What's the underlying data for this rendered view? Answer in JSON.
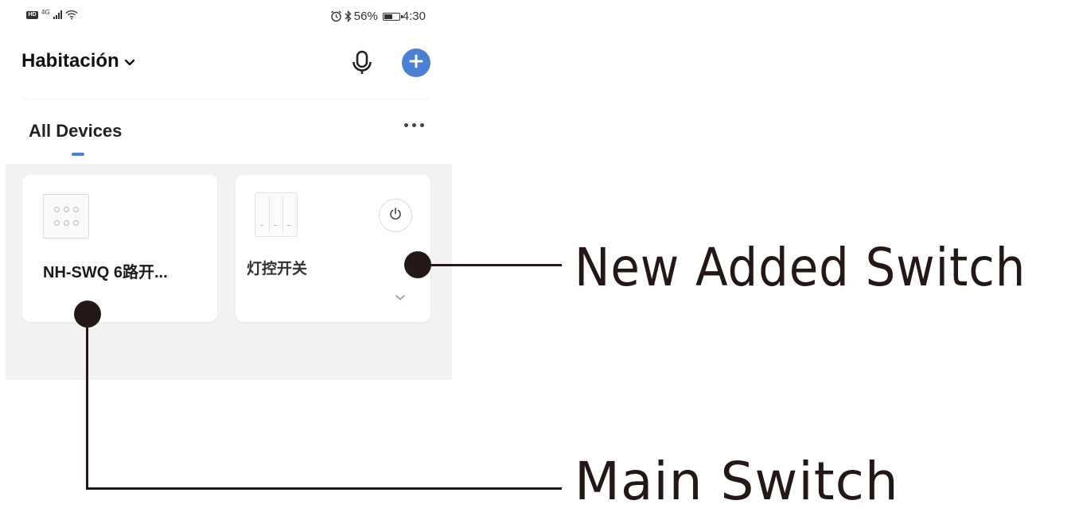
{
  "status_bar": {
    "hd": "HD",
    "network": "4G",
    "battery_percent": "56%",
    "battery_level": 0.56,
    "time": "4:30"
  },
  "header": {
    "room_name": "Habitación",
    "dropdown_icon": "chevron-down-icon",
    "mic_icon": "microphone-icon",
    "add_icon": "plus-icon",
    "accent_color": "#4a7fd4"
  },
  "tabs": [
    {
      "label": "All Devices",
      "active": true
    }
  ],
  "more_icon": "more-horizontal-icon",
  "devices": [
    {
      "name": "NH-SWQ 6路开...",
      "thumbnail": "six-button-switch"
    },
    {
      "name": "灯控开关",
      "thumbnail": "three-gang-switch",
      "power_icon": "power-icon",
      "expand_icon": "chevron-down-icon"
    }
  ],
  "annotations": {
    "new_added": "New Added Switch",
    "main": "Main Switch",
    "color": "#231815"
  }
}
